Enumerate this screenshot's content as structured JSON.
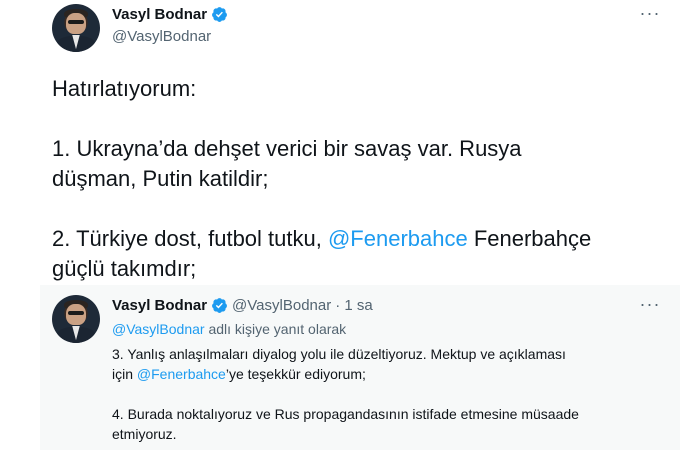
{
  "main_tweet": {
    "author_name": "Vasyl Bodnar",
    "author_handle": "@VasylBodnar",
    "lines": {
      "l1": "Hatırlatıyorum:",
      "l2a": "1. Ukrayna’da dehşet verici bir savaş var. Rusya",
      "l2b": "düşman, Putin katildir;",
      "l3a_pre": "2. Türkiye dost, futbol tutku, ",
      "l3a_mention": "@Fenerbahce",
      "l3a_post": " Fenerbahçe",
      "l3b": "güçlü takımdır;"
    }
  },
  "reply_tweet": {
    "author_name": "Vasyl Bodnar",
    "author_handle": "@VasylBodnar",
    "time": "· 1 sa",
    "replying_mention": "@VasylBodnar",
    "replying_suffix": " adlı kişiye yanıt olarak",
    "lines": {
      "p3a": "3. Yanlış anlaşılmaları diyalog yolu ile düzeltiyoruz. Mektup ve açıklaması",
      "p3b_pre": "için ",
      "p3b_mention": "@Fenerbahce",
      "p3b_post": "’ye teşekkür ediyorum;",
      "p4a": "4. Burada noktalıyoruz ve Rus propagandasının istifade etmesine müsaade",
      "p4b": "etmiyoruz."
    }
  },
  "icons": {
    "verified": "verified-badge-icon",
    "more": "more-options-icon"
  },
  "colors": {
    "accent": "#1d9bf0",
    "text": "#0f1419",
    "secondary": "#536471",
    "reply_background": "#f7f9f9"
  }
}
